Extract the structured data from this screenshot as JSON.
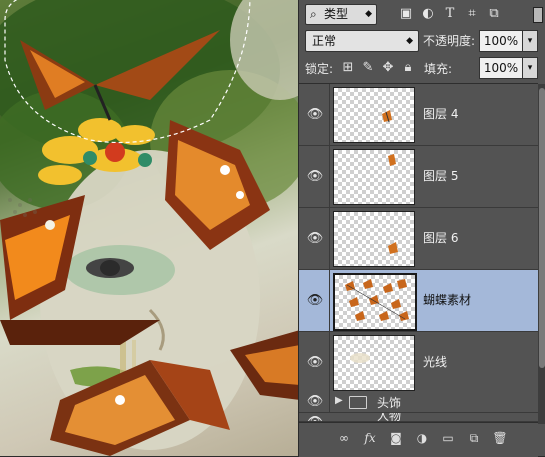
{
  "filter": {
    "kind_label": "类型",
    "search_icon": "search-icon"
  },
  "filter_icons": [
    "image-filter-icon",
    "adjustment-filter-icon",
    "type-filter-icon",
    "shape-filter-icon",
    "smart-object-filter-icon"
  ],
  "blend": {
    "mode": "正常",
    "opacity_label": "不透明度:",
    "opacity_value": "100%"
  },
  "lock": {
    "label": "锁定:",
    "fill_label": "填充:",
    "fill_value": "100%"
  },
  "layers": [
    {
      "name": "图层 4",
      "selected": false
    },
    {
      "name": "图层 5",
      "selected": false
    },
    {
      "name": "图层 6",
      "selected": false
    },
    {
      "name": "蝴蝶素材",
      "selected": true
    },
    {
      "name": "光线",
      "selected": false
    }
  ],
  "groups": [
    {
      "name": "头饰"
    },
    {
      "name": "人物"
    }
  ],
  "bottom_icons": [
    "link-icon",
    "fx-icon",
    "mask-icon",
    "adjustment-icon",
    "folder-icon",
    "new-layer-icon",
    "trash-icon"
  ],
  "colors": {
    "selection": "#a4b8d9",
    "panel": "#535353"
  }
}
